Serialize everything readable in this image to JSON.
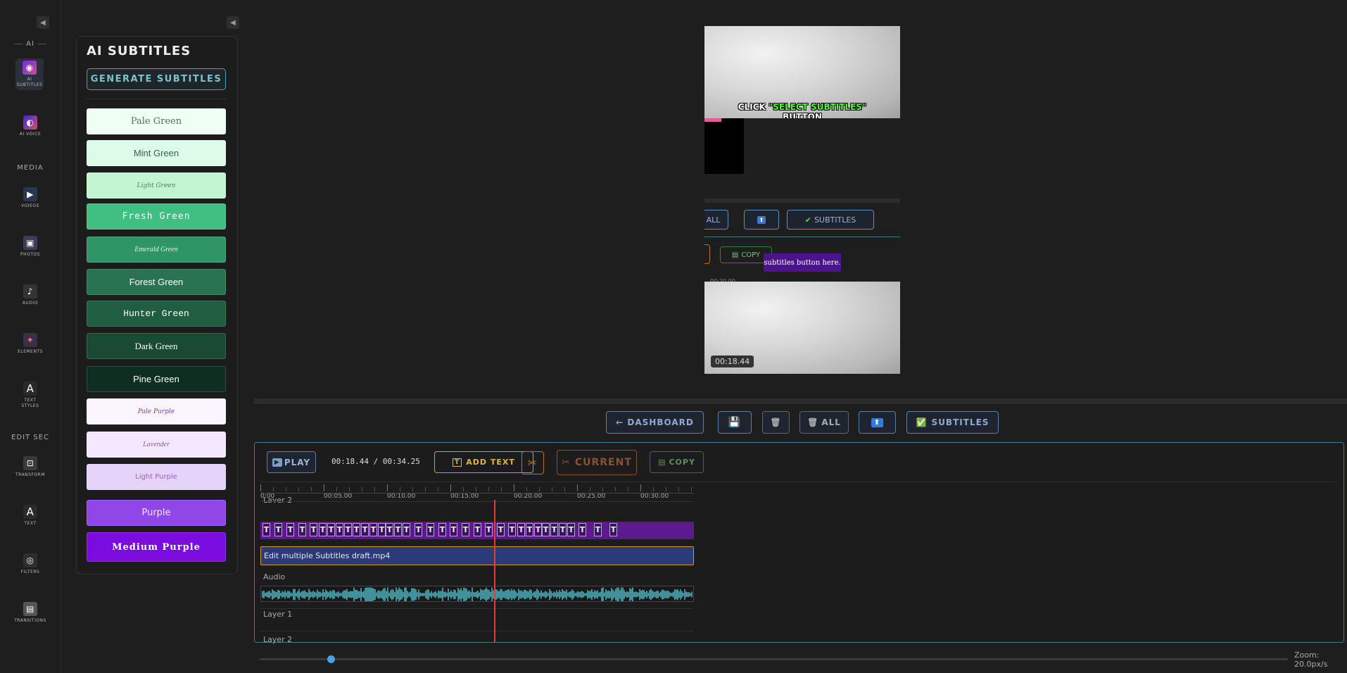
{
  "rail": {
    "sections": {
      "ai": "AI",
      "media": "MEDIA",
      "edit": "EDIT SEC"
    },
    "items": [
      {
        "label": "AI SUBTITLES",
        "icon": "ai-subtitles-icon",
        "active": true
      },
      {
        "label": "AI VOICE",
        "icon": "ai-voice-icon"
      },
      {
        "label": "VIDEOS",
        "icon": "videos-icon"
      },
      {
        "label": "PHOTOS",
        "icon": "photos-icon"
      },
      {
        "label": "AUDIO",
        "icon": "audio-icon"
      },
      {
        "label": "ELEMENTS",
        "icon": "elements-icon"
      },
      {
        "label": "TEXT STYLES",
        "icon": "text-styles-icon",
        "glyph": "A"
      },
      {
        "label": "TRANSFORM",
        "icon": "transform-icon"
      },
      {
        "label": "TEXT",
        "icon": "text-icon",
        "glyph": "A"
      },
      {
        "label": "FILTERS",
        "icon": "filters-icon"
      },
      {
        "label": "TRANSITIONS",
        "icon": "transitions-icon"
      }
    ],
    "collapse_glyph": "◀"
  },
  "panel": {
    "title": "AI SUBTITLES",
    "generate_label": "GENERATE SUBTITLES",
    "swatches": [
      {
        "label": "Pale Green",
        "bg": "#f0fff4",
        "fg": "#4a7a5a"
      },
      {
        "label": "Mint Green",
        "bg": "#dcfce7",
        "fg": "#2f6b45"
      },
      {
        "label": "Light Green",
        "bg": "#c3f5d2",
        "fg": "#3d8a55"
      },
      {
        "label": "Fresh Green",
        "bg": "#3fbf82",
        "fg": "#ffffff"
      },
      {
        "label": "Emerald Green",
        "bg": "#2f9466",
        "fg": "#d9f5e6"
      },
      {
        "label": "Forest Green",
        "bg": "#2a7350",
        "fg": "#ffffff"
      },
      {
        "label": "Hunter Green",
        "bg": "#1f5e40",
        "fg": "#ffffff"
      },
      {
        "label": "Dark Green",
        "bg": "#1a4a34",
        "fg": "#ffffff"
      },
      {
        "label": "Pine Green",
        "bg": "#0f2e22",
        "fg": "#ffffff"
      },
      {
        "label": "Pale Purple",
        "bg": "#faf5ff",
        "fg": "#7b3fb0"
      },
      {
        "label": "Lavender",
        "bg": "#f3e8ff",
        "fg": "#8a5aa8"
      },
      {
        "label": "Light Purple",
        "bg": "#e6d3fa",
        "fg": "#9a5ccc"
      },
      {
        "label": "Purple",
        "bg": "#9147e8",
        "fg": "#f1e6ff"
      },
      {
        "label": "Medium Purple",
        "bg": "#7a0ce0",
        "fg": "#ffffff"
      }
    ]
  },
  "preview": {
    "caption_pre": "CLICK ",
    "caption_hl": "\"SELECT SUBTITLES\"",
    "caption_post": " BUTTON",
    "inner_all": "ALL",
    "inner_subtitles": "SUBTITLES",
    "inner_copy": "COPY",
    "inner_tick": "00:20.00",
    "tooltip": "subtitles button here.",
    "time_badge": "00:18.44"
  },
  "toolbar": {
    "dashboard": "← DASHBOARD",
    "all": "ALL",
    "subtitles": "SUBTITLES"
  },
  "timeline": {
    "play": "PLAY",
    "current_time": "00:18.44",
    "total_time": "00:34.25",
    "time_sep": " / ",
    "add_text": "ADD TEXT",
    "current": "CURRENT",
    "copy": "COPY",
    "ticks": [
      "0:00",
      "00:05.00",
      "00:10.00",
      "00:15.00",
      "00:20.00",
      "00:25.00",
      "00:30.00"
    ],
    "tracks": {
      "layer2_top": "Layer 2",
      "audio": "Audio",
      "layer1": "Layer 1",
      "layer2": "Layer 2"
    },
    "video_clip": "Edit multiple Subtitles draft.mp4",
    "text_glyph": "T",
    "zoom_label": "Zoom:",
    "zoom_value": "20.0px/s",
    "zoom_fraction": 0.07
  }
}
